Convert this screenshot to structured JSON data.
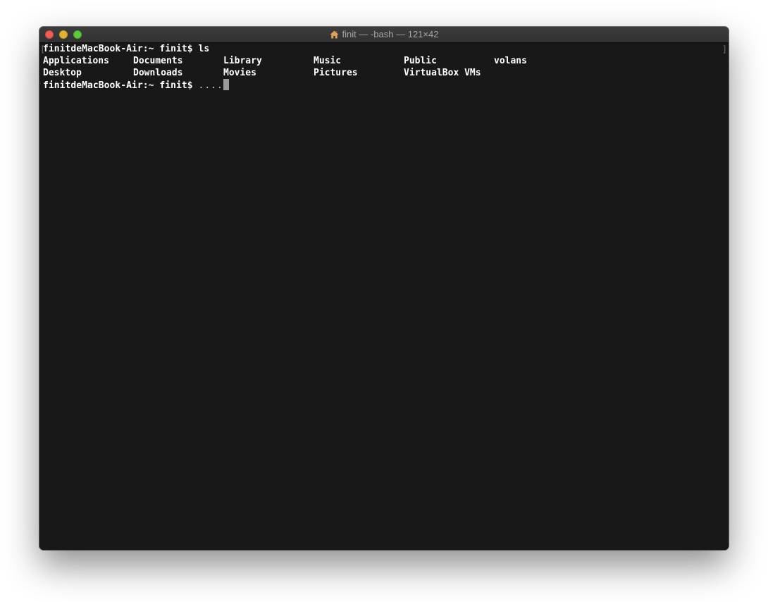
{
  "window": {
    "title": "finit — -bash — 121×42",
    "title_icon": "home-icon"
  },
  "terminal": {
    "bracket_left": "[",
    "bracket_right": "]",
    "prompt_line_1": "finitdeMacBook-Air:~ finit$ ls",
    "ls_output": {
      "row1": [
        "Applications",
        "Documents",
        "Library",
        "Music",
        "Public",
        "volans"
      ],
      "row2": [
        "Desktop",
        "Downloads",
        "Movies",
        "Pictures",
        "VirtualBox VMs"
      ]
    },
    "prompt_line_2": "finitdeMacBook-Air:~ finit$ ",
    "typed_input": "....",
    "colors": {
      "background": "#181818",
      "text": "#ffffff",
      "cursor": "#9a9a9a"
    }
  }
}
